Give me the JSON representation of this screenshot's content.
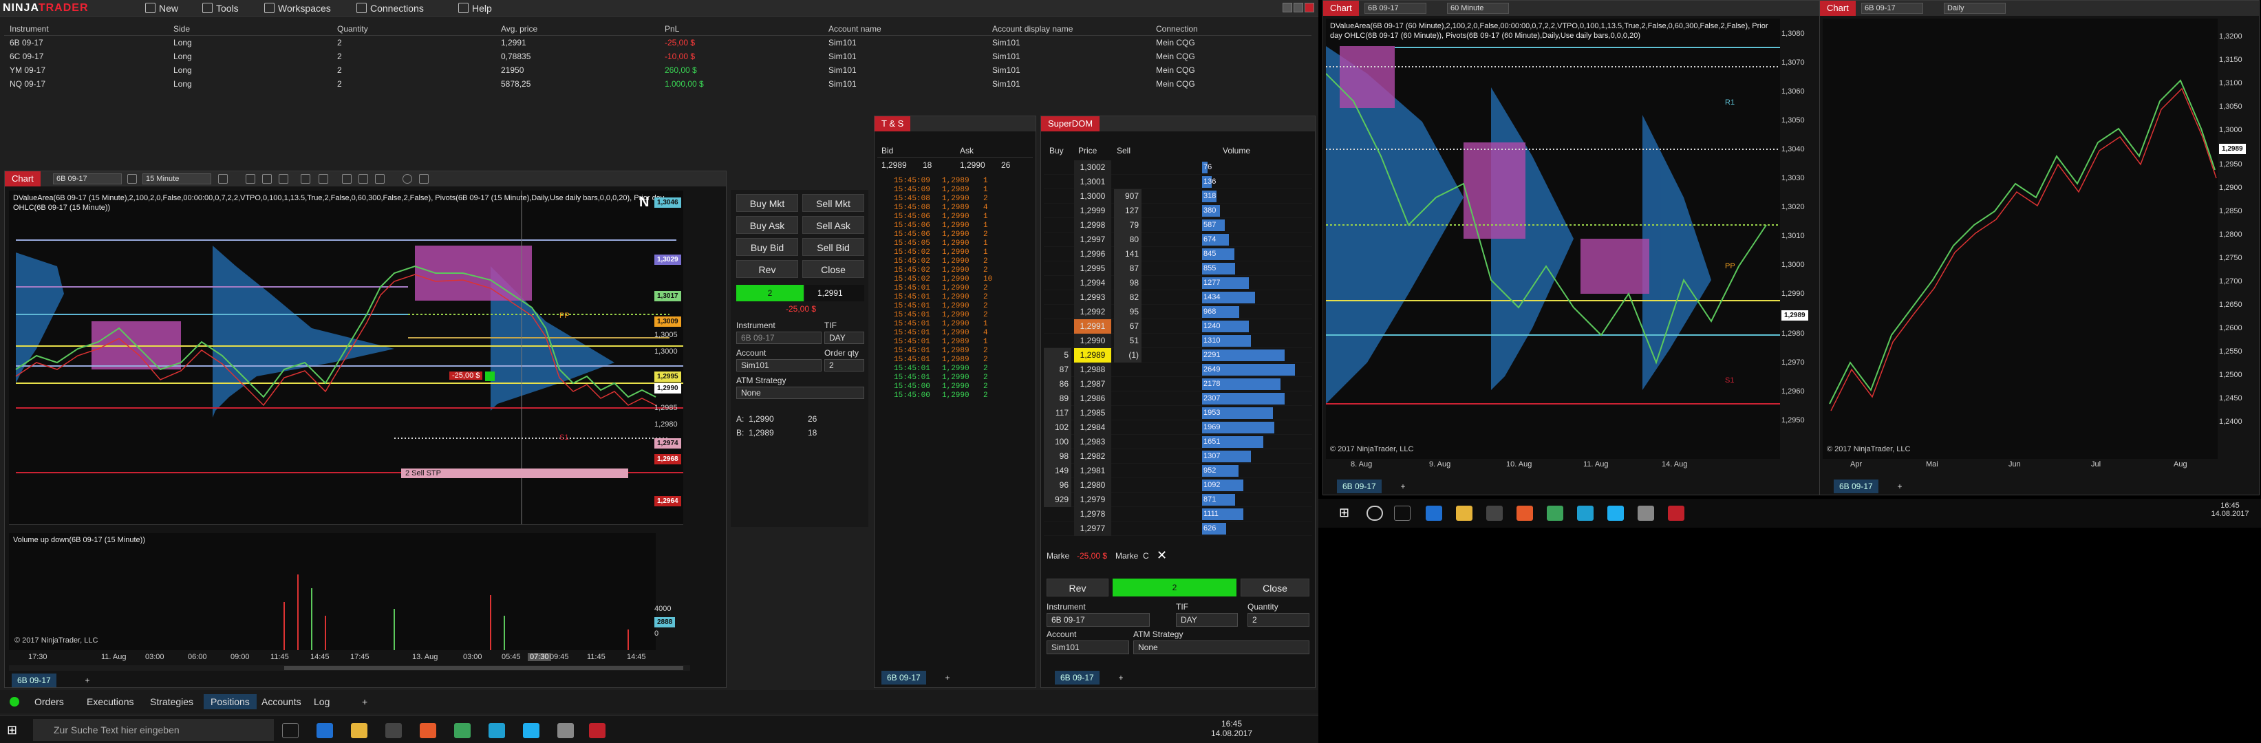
{
  "app": {
    "logo_ninja": "NINJA",
    "logo_trader": "TRADER"
  },
  "menu": [
    {
      "label": "New",
      "icon": "new-icon"
    },
    {
      "label": "Tools",
      "icon": "tools-icon"
    },
    {
      "label": "Workspaces",
      "icon": "workspaces-icon"
    },
    {
      "label": "Connections",
      "icon": "connections-icon"
    },
    {
      "label": "Help",
      "icon": "help-icon"
    }
  ],
  "positions": {
    "headers": [
      "Instrument",
      "Side",
      "Quantity",
      "Avg. price",
      "PnL",
      "Account name",
      "Account display name",
      "Connection"
    ],
    "rows": [
      {
        "instrument": "6B 09-17",
        "side": "Long",
        "qty": "2",
        "avg": "1,2991",
        "pnl": "-25,00 $",
        "acct": "Sim101",
        "disp": "Sim101",
        "conn": "Mein CQG"
      },
      {
        "instrument": "6C 09-17",
        "side": "Long",
        "qty": "2",
        "avg": "0,78835",
        "pnl": "-10,00 $",
        "acct": "Sim101",
        "disp": "Sim101",
        "conn": "Mein CQG"
      },
      {
        "instrument": "YM 09-17",
        "side": "Long",
        "qty": "2",
        "avg": "21950",
        "pnl": "260,00 $",
        "acct": "Sim101",
        "disp": "Sim101",
        "conn": "Mein CQG"
      },
      {
        "instrument": "NQ 09-17",
        "side": "Long",
        "qty": "2",
        "avg": "5878,25",
        "pnl": "1.000,00 $",
        "acct": "Sim101",
        "disp": "Sim101",
        "conn": "Mein CQG"
      }
    ]
  },
  "chart1": {
    "tag": "Chart",
    "instrument": "6B 09-17",
    "interval": "15 Minute",
    "indicator_text": "DValueArea(6B 09-17 (15 Minute),2,100,2,0,False,00:00:00,0,7,2,2,VTPO,0,100,1,13.5,True,2,False,0,60,300,False,2,False), Pivots(6B 09-17 (15 Minute),Daily,Use daily bars,0,0,0,20), Prior day OHLC(6B 09-17 (15 Minute))",
    "volume_label": "Volume up down(6B 09-17 (15 Minute))",
    "copyright": "© 2017 NinjaTrader, LLC",
    "price_labels": [
      "1,3046",
      "1,3029",
      "1,3017",
      "1,3009",
      "1,3005",
      "1,3000",
      "1,2995",
      "1,2990",
      "1,2985",
      "1,2980",
      "1,2974",
      "1,2968",
      "1,2964"
    ],
    "time_labels": [
      "17:30",
      "11. Aug",
      "03:00",
      "06:00",
      "09:00",
      "11:45",
      "14:45",
      "17:45",
      "13. Aug",
      "03:00",
      "05:45",
      "07:30",
      "09:45",
      "11:45",
      "14:45",
      "17:45"
    ],
    "vol_labels": [
      "4000",
      "2888",
      "0"
    ],
    "order_label": "2  Sell STP",
    "pnl_flag": "-25,00 $",
    "pp_label": "PP",
    "s1_label": "S1",
    "tab": "6B 09-17"
  },
  "chart_trader": {
    "buy_mkt": "Buy Mkt",
    "sell_mkt": "Sell Mkt",
    "buy_ask": "Buy Ask",
    "sell_ask": "Sell Ask",
    "buy_bid": "Buy Bid",
    "sell_bid": "Sell Bid",
    "rev": "Rev",
    "close": "Close",
    "pos_qty": "2",
    "pos_price": "1,2991",
    "pos_pnl": "-25,00 $",
    "instrument_lbl": "Instrument",
    "tif_lbl": "TIF",
    "instrument": "6B 09-17",
    "tif": "DAY",
    "account_lbl": "Account",
    "orderqty_lbl": "Order qty",
    "account": "Sim101",
    "orderqty": "2",
    "atm_lbl": "ATM Strategy",
    "atm": "None",
    "ask_lbl": "A:",
    "ask": "1,2990",
    "ask_sz": "26",
    "bid_lbl": "B:",
    "bid": "1,2989",
    "bid_sz": "18"
  },
  "ts": {
    "title": "T & S",
    "bid_hdr": "Bid",
    "ask_hdr": "Ask",
    "bid": "1,2989",
    "bid_sz": "18",
    "ask": "1,2990",
    "ask_sz": "26",
    "tab": "6B 09-17",
    "rows": [
      [
        "15:45:09",
        "1,2989",
        "1",
        "o"
      ],
      [
        "15:45:09",
        "1,2989",
        "1",
        "o"
      ],
      [
        "15:45:08",
        "1,2990",
        "2",
        "o"
      ],
      [
        "15:45:08",
        "1,2989",
        "4",
        "o"
      ],
      [
        "15:45:06",
        "1,2990",
        "1",
        "o"
      ],
      [
        "15:45:06",
        "1,2990",
        "1",
        "o"
      ],
      [
        "15:45:06",
        "1,2990",
        "2",
        "o"
      ],
      [
        "15:45:05",
        "1,2990",
        "1",
        "o"
      ],
      [
        "15:45:02",
        "1,2990",
        "1",
        "o"
      ],
      [
        "15:45:02",
        "1,2990",
        "2",
        "o"
      ],
      [
        "15:45:02",
        "1,2990",
        "2",
        "o"
      ],
      [
        "15:45:02",
        "1,2990",
        "10",
        "o"
      ],
      [
        "15:45:01",
        "1,2990",
        "2",
        "o"
      ],
      [
        "15:45:01",
        "1,2990",
        "2",
        "o"
      ],
      [
        "15:45:01",
        "1,2990",
        "2",
        "o"
      ],
      [
        "15:45:01",
        "1,2990",
        "2",
        "o"
      ],
      [
        "15:45:01",
        "1,2990",
        "1",
        "o"
      ],
      [
        "15:45:01",
        "1,2990",
        "4",
        "o"
      ],
      [
        "15:45:01",
        "1,2989",
        "1",
        "o"
      ],
      [
        "15:45:01",
        "1,2989",
        "2",
        "o"
      ],
      [
        "15:45:01",
        "1,2989",
        "2",
        "o"
      ],
      [
        "15:45:01",
        "1,2990",
        "2",
        "g"
      ],
      [
        "15:45:01",
        "1,2990",
        "2",
        "g"
      ],
      [
        "15:45:00",
        "1,2990",
        "2",
        "g"
      ],
      [
        "15:45:00",
        "1,2990",
        "2",
        "g"
      ]
    ]
  },
  "dom": {
    "title": "SuperDOM",
    "headers": [
      "Buy",
      "Price",
      "Sell",
      "Volume"
    ],
    "rows": [
      {
        "buy": "",
        "price": "1,3002",
        "sell": "",
        "vol": "76",
        "w": 0.05
      },
      {
        "buy": "",
        "price": "1,3001",
        "sell": "",
        "vol": "136",
        "w": 0.09
      },
      {
        "buy": "",
        "price": "1,3000",
        "sell": "907",
        "vol": "318",
        "w": 0.14
      },
      {
        "buy": "",
        "price": "1,2999",
        "sell": "127",
        "vol": "380",
        "w": 0.17
      },
      {
        "buy": "",
        "price": "1,2998",
        "sell": "79",
        "vol": "587",
        "w": 0.22
      },
      {
        "buy": "",
        "price": "1,2997",
        "sell": "80",
        "vol": "674",
        "w": 0.26
      },
      {
        "buy": "",
        "price": "1,2996",
        "sell": "141",
        "vol": "845",
        "w": 0.31
      },
      {
        "buy": "",
        "price": "1,2995",
        "sell": "87",
        "vol": "855",
        "w": 0.32
      },
      {
        "buy": "",
        "price": "1,2994",
        "sell": "98",
        "vol": "1277",
        "w": 0.45
      },
      {
        "buy": "",
        "price": "1,2993",
        "sell": "82",
        "vol": "1434",
        "w": 0.51
      },
      {
        "buy": "",
        "price": "1,2992",
        "sell": "95",
        "vol": "968",
        "w": 0.36
      },
      {
        "buy": "",
        "price": "1,2991",
        "sell": "67",
        "vol": "1240",
        "w": 0.45
      },
      {
        "buy": "",
        "price": "1,2990",
        "sell": "51",
        "vol": "1310",
        "w": 0.47
      },
      {
        "buy": "5",
        "price": "1,2989",
        "sell": "(1)",
        "vol": "2291",
        "w": 0.8
      },
      {
        "buy": "87",
        "price": "1,2988",
        "sell": "",
        "vol": "2649",
        "w": 0.9
      },
      {
        "buy": "86",
        "price": "1,2987",
        "sell": "",
        "vol": "2178",
        "w": 0.76
      },
      {
        "buy": "89",
        "price": "1,2986",
        "sell": "",
        "vol": "2307",
        "w": 0.8
      },
      {
        "buy": "117",
        "price": "1,2985",
        "sell": "",
        "vol": "1953",
        "w": 0.69
      },
      {
        "buy": "102",
        "price": "1,2984",
        "sell": "",
        "vol": "1969",
        "w": 0.7
      },
      {
        "buy": "100",
        "price": "1,2983",
        "sell": "",
        "vol": "1651",
        "w": 0.59
      },
      {
        "buy": "98",
        "price": "1,2982",
        "sell": "",
        "vol": "1307",
        "w": 0.47
      },
      {
        "buy": "149",
        "price": "1,2981",
        "sell": "",
        "vol": "952",
        "w": 0.35
      },
      {
        "buy": "96",
        "price": "1,2980",
        "sell": "",
        "vol": "1092",
        "w": 0.4
      },
      {
        "buy": "929",
        "price": "1,2979",
        "sell": "",
        "vol": "871",
        "w": 0.32
      },
      {
        "buy": "",
        "price": "1,2978",
        "sell": "",
        "vol": "1111",
        "w": 0.4
      },
      {
        "buy": "",
        "price": "1,2977",
        "sell": "",
        "vol": "626",
        "w": 0.23
      }
    ],
    "market_lbl": "Marke",
    "pnl": "-25,00 $",
    "market_lbl2": "Marke",
    "c_lbl": "C",
    "rev": "Rev",
    "pos_qty": "2",
    "close": "Close",
    "instrument_lbl": "Instrument",
    "tif_lbl": "TIF",
    "qty_lbl": "Quantity",
    "instrument": "6B 09-17",
    "tif": "DAY",
    "qty": "2",
    "account_lbl": "Account",
    "atm_lbl": "ATM Strategy",
    "account": "Sim101",
    "atm": "None",
    "tab": "6B 09-17"
  },
  "tabs": [
    "Orders",
    "Executions",
    "Strategies",
    "Positions",
    "Accounts",
    "Log"
  ],
  "taskbar": {
    "search": "Zur Suche Text hier eingeben",
    "time": "16:45",
    "date": "14.08.2017"
  },
  "chart2": {
    "tag": "Chart",
    "instrument": "6B 09-17",
    "interval": "60 Minute",
    "indicator_text": "DValueArea(6B 09-17 (60 Minute),2,100,2,0,False,00:00:00,0,7,2,2,VTPO,0,100,1,13.5,True,2,False,0,60,300,False,2,False), Prior day OHLC(6B 09-17 (60 Minute)), Pivots(6B 09-17 (60 Minute),Daily,Use daily bars,0,0,0,20)",
    "price_labels": [
      "1,3080",
      "1,3070",
      "1,3060",
      "1,3050",
      "1,3040",
      "1,3030",
      "1,3020",
      "1,3010",
      "1,3000",
      "1,2990",
      "1,2989",
      "1,2980",
      "1,2970",
      "1,2960",
      "1,2950"
    ],
    "time_labels": [
      "8. Aug",
      "9. Aug",
      "10. Aug",
      "11. Aug",
      "14. Aug"
    ],
    "r1": "R1",
    "pp": "PP",
    "s1": "S1",
    "copyright": "© 2017 NinjaTrader, LLC",
    "tab": "6B 09-17"
  },
  "chart3": {
    "tag": "Chart",
    "instrument": "6B 09-17",
    "interval": "Daily",
    "price_labels": [
      "1,3200",
      "1,3150",
      "1,3100",
      "1,3050",
      "1,3000",
      "1,2989",
      "1,2950",
      "1,2900",
      "1,2850",
      "1,2800",
      "1,2750",
      "1,2700",
      "1,2650",
      "1,2600",
      "1,2550",
      "1,2500",
      "1,2450",
      "1,2400"
    ],
    "time_labels": [
      "Apr",
      "Mai",
      "Jun",
      "Jul",
      "Aug"
    ],
    "copyright": "© 2017 NinjaTrader, LLC",
    "tab": "6B 09-17"
  },
  "taskbar2": {
    "time": "16:45",
    "date": "14.08.2017"
  },
  "colors": {
    "accent": "#c0202a",
    "green": "#19d119",
    "buy_blue": "#3a78c8",
    "profile_blue": "#1f5f9a",
    "profile_magenta": "#b04aa8"
  }
}
